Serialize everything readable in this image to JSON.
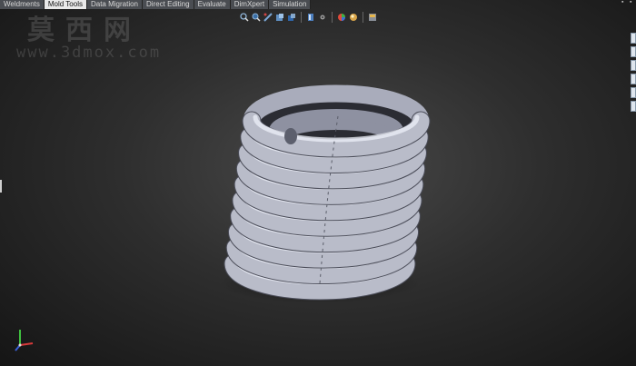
{
  "tabs": [
    {
      "label": "Weldments",
      "active": false
    },
    {
      "label": "Mold Tools",
      "active": true
    },
    {
      "label": "Data Migration",
      "active": false
    },
    {
      "label": "Direct Editing",
      "active": false
    },
    {
      "label": "Evaluate",
      "active": false
    },
    {
      "label": "DimXpert",
      "active": false
    },
    {
      "label": "Simulation",
      "active": false
    }
  ],
  "watermark": {
    "chinese": "莫西网",
    "url": "www.3dmox.com"
  },
  "heads_up_toolbar": [
    "zoom-to-fit-icon",
    "zoom-to-area-icon",
    "previous-view-icon",
    "section-view-icon",
    "view-orientation-icon",
    "display-style-icon",
    "hide-show-items-icon",
    "edit-appearance-icon",
    "apply-scene-icon",
    "view-settings-icon"
  ],
  "colors": {
    "tab_active": "#e9e9e9",
    "tab_inactive": "#4a4d52",
    "model": "#b9bcc9",
    "background": "#2e2e2e"
  },
  "model": {
    "type": "helical-coil",
    "turns": 10
  }
}
